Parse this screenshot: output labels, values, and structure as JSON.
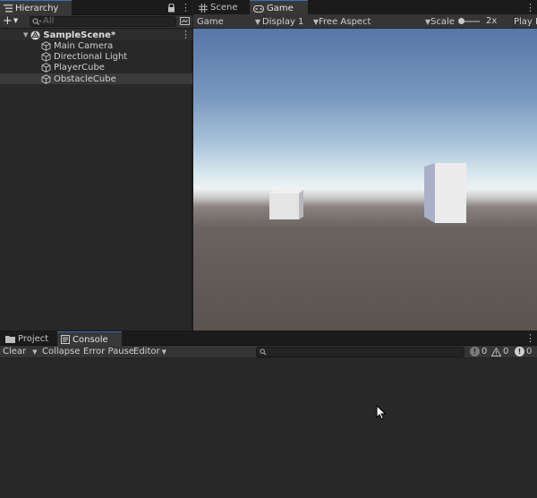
{
  "hierarchy": {
    "tab_label": "Hierarchy",
    "search_placeholder": "All",
    "scene_name": "SampleScene*",
    "objects": [
      {
        "label": "Main Camera"
      },
      {
        "label": "Directional Light"
      },
      {
        "label": "PlayerCube"
      },
      {
        "label": "ObstacleCube",
        "selected": true
      }
    ]
  },
  "view": {
    "tabs": [
      {
        "label": "Scene",
        "icon": "grid-icon"
      },
      {
        "label": "Game",
        "icon": "gamepad-icon",
        "active": true
      }
    ],
    "toolbar": {
      "mode": "Game",
      "display": "Display 1",
      "aspect": "Free Aspect",
      "scale_label": "Scale",
      "scale_value": "2x",
      "play_label": "Play F"
    }
  },
  "bottom": {
    "tabs": [
      {
        "label": "Project",
        "icon": "folder-icon"
      },
      {
        "label": "Console",
        "icon": "console-icon",
        "active": true
      }
    ],
    "console_toolbar": {
      "clear": "Clear",
      "collapse": "Collapse",
      "error_pause": "Error Pause",
      "editor": "Editor",
      "info_count": "0",
      "warning_count": "0",
      "error_count": "0"
    }
  },
  "colors": {
    "accent": "#3d6fb0",
    "panel_bg": "#282828",
    "sky_top": "#5a7aa8",
    "horizon": "#e6f0f4",
    "ground": "#5a5350"
  }
}
